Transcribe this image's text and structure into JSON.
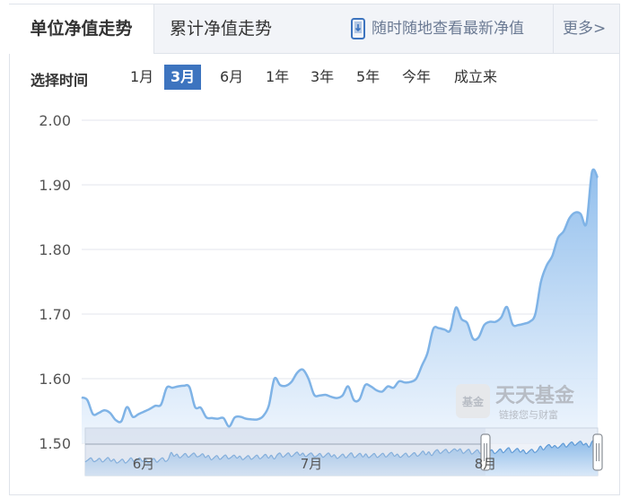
{
  "tabs": {
    "unit_nav": "单位净值走势",
    "cumulative_nav": "累计净值走势",
    "mobile_prompt": "随时随地查看最新净值",
    "more": "更多>"
  },
  "range": {
    "label": "选择时间",
    "options": [
      "1月",
      "3月",
      "6月",
      "1年",
      "3年",
      "5年",
      "今年",
      "成立来"
    ],
    "selected": "3月"
  },
  "watermark": {
    "logo_text": "基金",
    "name": "天天基金",
    "slogan": "链接您与财富"
  },
  "colors": {
    "line": "#7fb3e6",
    "area_top": "#8dbcec",
    "area_bottom": "#eef5fd",
    "active_button": "#3d74bf",
    "grid": "#e3e6ec"
  },
  "chart_data": {
    "type": "area",
    "ylim": [
      1.5,
      2.0
    ],
    "yticks": [
      "2.00",
      "1.90",
      "1.80",
      "1.70",
      "1.60",
      "1.50"
    ],
    "navigator_ticks": [
      "6月",
      "7月",
      "8月"
    ],
    "series": [
      {
        "values": [
          1.571,
          1.567,
          1.545,
          1.547,
          1.551,
          1.547,
          1.536,
          1.534,
          1.556,
          1.541,
          1.545,
          1.549,
          1.553,
          1.558,
          1.56,
          1.586,
          1.586,
          1.588,
          1.589,
          1.587,
          1.556,
          1.555,
          1.54,
          1.539,
          1.538,
          1.539,
          1.526,
          1.54,
          1.541,
          1.538,
          1.537,
          1.537,
          1.542,
          1.558,
          1.6,
          1.59,
          1.589,
          1.595,
          1.609,
          1.614,
          1.6,
          1.575,
          1.574,
          1.575,
          1.572,
          1.57,
          1.574,
          1.588,
          1.567,
          1.568,
          1.59,
          1.588,
          1.582,
          1.58,
          1.588,
          1.586,
          1.596,
          1.594,
          1.595,
          1.6,
          1.62,
          1.64,
          1.677,
          1.678,
          1.676,
          1.675,
          1.71,
          1.692,
          1.686,
          1.662,
          1.664,
          1.683,
          1.688,
          1.688,
          1.695,
          1.711,
          1.684,
          1.683,
          1.685,
          1.688,
          1.7,
          1.75,
          1.775,
          1.79,
          1.818,
          1.828,
          1.848,
          1.857,
          1.855,
          1.84,
          1.92,
          1.911
        ]
      }
    ]
  }
}
